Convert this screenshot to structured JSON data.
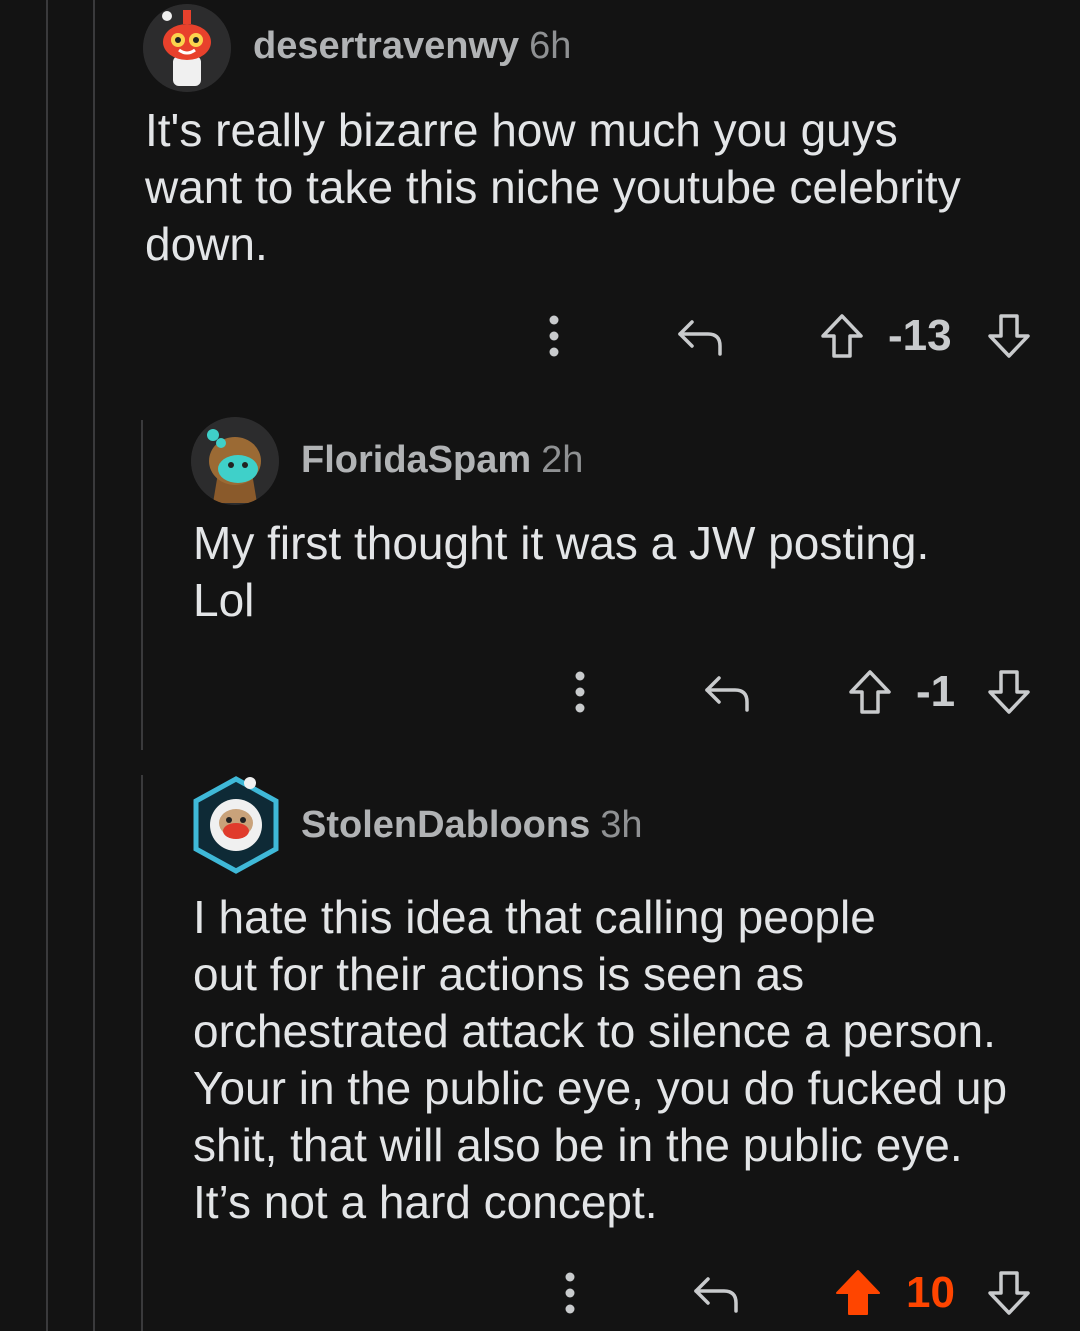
{
  "comments": [
    {
      "username": "desertravenwy",
      "time": "6h",
      "body": "It's really bizarre how much you guys\nwant to take this niche youtube celebrity\ndown.",
      "score": "-13",
      "upvoted": false
    },
    {
      "username": "FloridaSpam",
      "time": "2h",
      "body": "My first thought it was a JW posting.\nLol",
      "score": "-1",
      "upvoted": false
    },
    {
      "username": "StolenDabloons",
      "time": "3h",
      "body": "I hate this idea that calling people\nout for their actions is seen as\norchestrated attack to silence a person.\nYour in the public eye, you do fucked up\nshit, that will also be in the public eye.\nIt’s not a hard concept.",
      "score": "10",
      "upvoted": true
    }
  ],
  "icons": {
    "more": "more-vertical-icon",
    "reply": "reply-arrow-icon",
    "upvote": "upvote-arrow-icon",
    "downvote": "downvote-arrow-icon"
  },
  "colors": {
    "background": "#131313",
    "upvote_active": "#ff4500",
    "thread_line": "#3a3a3c"
  }
}
